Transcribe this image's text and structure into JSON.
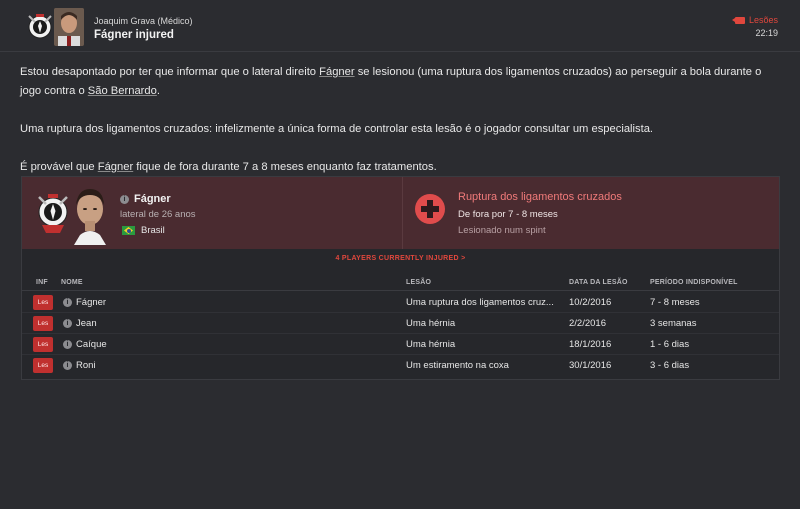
{
  "header": {
    "sender": "Joaquim Grava  (Médico)",
    "subject": "Fágner injured",
    "category": "Lesões",
    "time": "22:19"
  },
  "message": {
    "p1_before_player": "Estou desapontado por ter que informar que o lateral direito ",
    "p1_player": "Fágner",
    "p1_middle": " se lesionou (uma ruptura dos ligamentos cruzados) ao perseguir a bola durante o jogo contra o ",
    "p1_opponent": "São Bernardo",
    "p1_end": ".",
    "p2": "Uma ruptura dos ligamentos cruzados: infelizmente a única forma de controlar esta lesão é o jogador consultar um especialista.",
    "p3_before_player": "É provável que ",
    "p3_player": "Fágner",
    "p3_end": " fique de fora durante 7 a 8 meses enquanto faz tratamentos."
  },
  "player": {
    "name": "Fágner",
    "role": "lateral de 26 anos",
    "nation": "Brasil"
  },
  "injury": {
    "title": "Ruptura dos ligamentos cruzados",
    "duration": "De fora por 7 - 8 meses",
    "cause": "Lesionado num spint"
  },
  "injured_link": "4 PLAYERS CURRENTLY INJURED >",
  "table": {
    "headers": {
      "inf": "INF",
      "name": "NOME",
      "injury": "LESÃO",
      "date": "DATA DA LESÃO",
      "period": "PERÍODO INDISPONÍVEL"
    },
    "rows": [
      {
        "badge": "Les",
        "name": "Fágner",
        "injury": "Uma ruptura dos ligamentos cruz...",
        "date": "10/2/2016",
        "period": "7 - 8 meses"
      },
      {
        "badge": "Les",
        "name": "Jean",
        "injury": "Uma hérnia",
        "date": "2/2/2016",
        "period": "3 semanas"
      },
      {
        "badge": "Les",
        "name": "Caíque",
        "injury": "Uma hérnia",
        "date": "18/1/2016",
        "period": "1 - 6 dias"
      },
      {
        "badge": "Les",
        "name": "Roni",
        "injury": "Um estiramento na coxa",
        "date": "30/1/2016",
        "period": "3 - 6 dias"
      }
    ]
  },
  "colors": {
    "accent": "#e0473d",
    "panel": "#4a2b30",
    "background": "#2b2c30"
  }
}
